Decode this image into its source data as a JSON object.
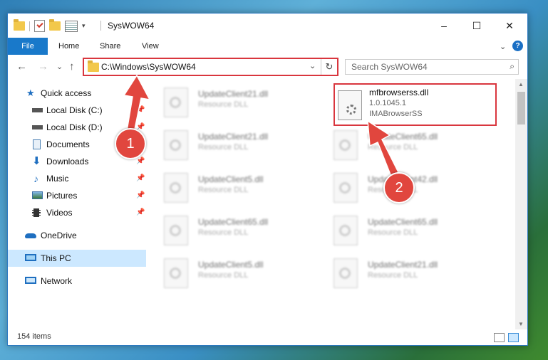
{
  "window": {
    "title": "SysWOW64",
    "minimize": "–",
    "maximize": "☐",
    "close": "✕"
  },
  "ribbon": {
    "tabs": [
      "File",
      "Home",
      "Share",
      "View"
    ],
    "expand": "⌄",
    "help": "?"
  },
  "nav": {
    "back": "←",
    "forward": "→",
    "recent": "⌄",
    "up": "↑"
  },
  "address": {
    "path": "C:\\Windows\\SysWOW64",
    "dropdown": "⌄",
    "refresh": "↻"
  },
  "search": {
    "placeholder": "Search SysWOW64",
    "icon": "⌕"
  },
  "sidebar": {
    "items": [
      {
        "label": "Quick access",
        "icon": "star-icon"
      },
      {
        "label": "Local Disk (C:)",
        "icon": "drive-icon"
      },
      {
        "label": "Local Disk (D:)",
        "icon": "drive-icon"
      },
      {
        "label": "Documents",
        "icon": "documents-icon"
      },
      {
        "label": "Downloads",
        "icon": "download-icon"
      },
      {
        "label": "Music",
        "icon": "music-icon"
      },
      {
        "label": "Pictures",
        "icon": "pictures-icon"
      },
      {
        "label": "Videos",
        "icon": "videos-icon"
      },
      {
        "label": "OneDrive",
        "icon": "cloud-icon"
      },
      {
        "label": "This PC",
        "icon": "pc-icon"
      },
      {
        "label": "Network",
        "icon": "network-icon"
      }
    ],
    "pin": "📌"
  },
  "files": {
    "featured": {
      "name": "mfbrowserss.dll",
      "version": "1.0.1045.1",
      "company": "IMABrowserSS"
    },
    "left": [
      {
        "name": "UpdateClient21.dll",
        "type": "Resource DLL"
      },
      {
        "name": "UpdateClient21.dll",
        "type": "Resource DLL"
      },
      {
        "name": "UpdateClient5.dll",
        "type": "Resource DLL"
      },
      {
        "name": "UpdateClient65.dll",
        "type": "Resource DLL"
      },
      {
        "name": "UpdateClient5.dll",
        "type": "Resource DLL"
      }
    ],
    "right": [
      {
        "name": "UpdateClient65.dll",
        "type": "Resource DLL"
      },
      {
        "name": "UpdateClient42.dll",
        "type": "Resource DLL"
      },
      {
        "name": "UpdateClient65.dll",
        "type": "Resource DLL"
      },
      {
        "name": "UpdateClient21.dll",
        "type": "Resource DLL"
      }
    ]
  },
  "status": {
    "count": "154 items"
  },
  "callouts": {
    "one": "1",
    "two": "2"
  },
  "colors": {
    "accent": "#1979ca",
    "highlight": "#d9363e",
    "selected": "#cce8ff"
  }
}
